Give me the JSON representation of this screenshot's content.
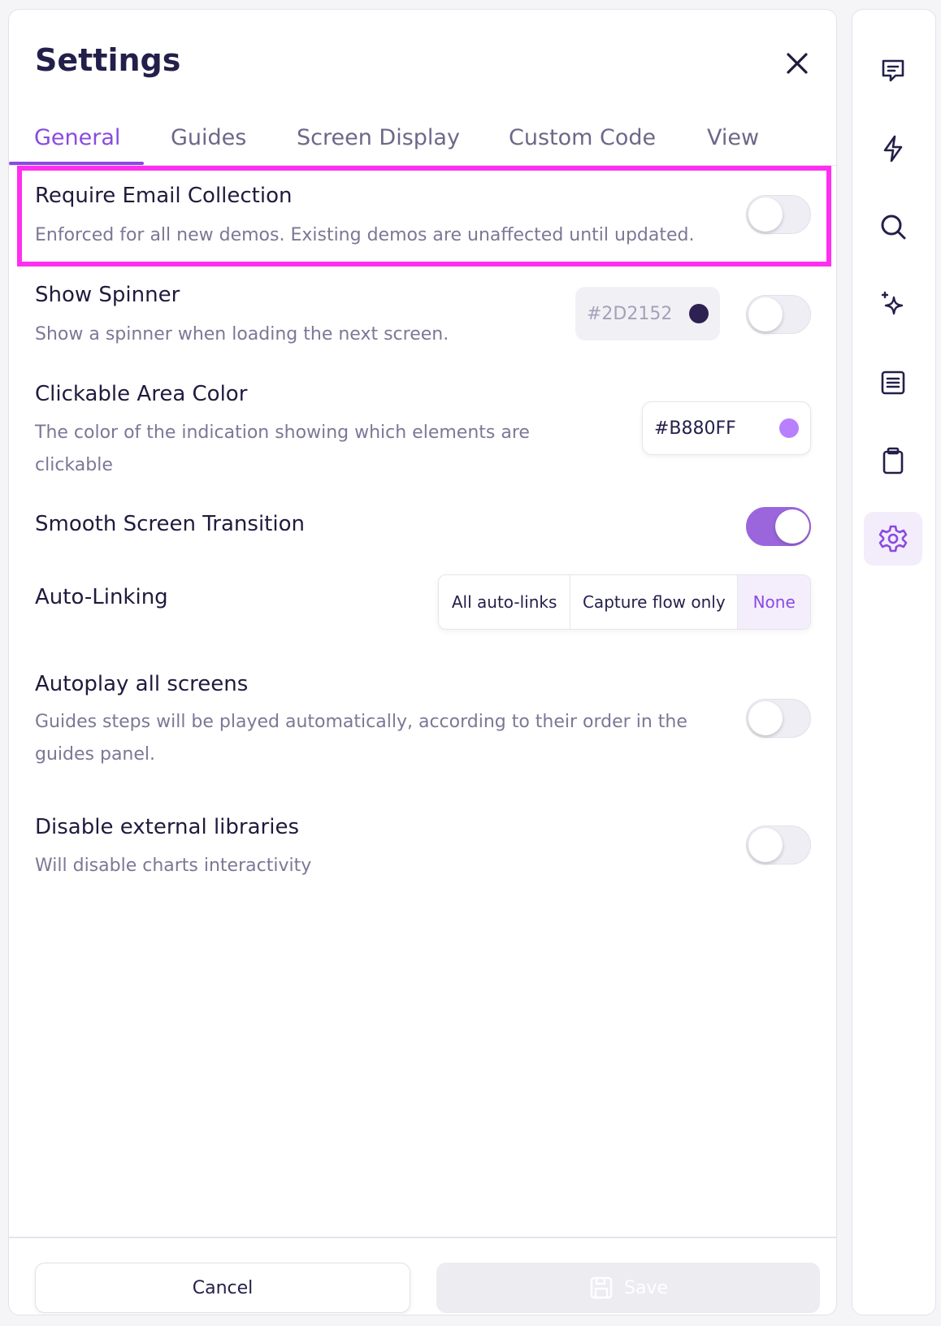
{
  "header": {
    "title": "Settings"
  },
  "tabs": [
    {
      "label": "General",
      "active": true
    },
    {
      "label": "Guides"
    },
    {
      "label": "Screen Display"
    },
    {
      "label": "Custom Code"
    },
    {
      "label": "View"
    }
  ],
  "settings": {
    "require_email": {
      "title": "Require Email Collection",
      "description": "Enforced for all new demos. Existing demos are unaffected until updated.",
      "enabled": false
    },
    "show_spinner": {
      "title": "Show Spinner",
      "description": "Show a spinner when loading the next screen.",
      "color": "#2D2152",
      "enabled": false
    },
    "clickable_area_color": {
      "title": "Clickable Area Color",
      "description": "The color of the indication showing which elements are clickable",
      "color": "#B880FF"
    },
    "smooth_transition": {
      "title": "Smooth Screen Transition",
      "enabled": true
    },
    "auto_linking": {
      "title": "Auto-Linking",
      "options": [
        "All auto-links",
        "Capture flow only",
        "None"
      ],
      "selected": "None"
    },
    "autoplay": {
      "title": "Autoplay all screens",
      "description": "Guides steps will be played automatically, according to their order in the guides panel.",
      "enabled": false
    },
    "disable_external": {
      "title": "Disable external libraries",
      "description": "Will disable charts interactivity",
      "enabled": false
    }
  },
  "footer": {
    "cancel_label": "Cancel",
    "save_label": "Save"
  },
  "rail": {
    "items": [
      {
        "icon": "comment-icon"
      },
      {
        "icon": "lightning-icon"
      },
      {
        "icon": "search-icon"
      },
      {
        "icon": "sparkle-icon"
      },
      {
        "icon": "document-icon"
      },
      {
        "icon": "clipboard-icon"
      },
      {
        "icon": "gear-icon",
        "active": true
      }
    ]
  },
  "colors": {
    "accent": "#8A4AE0",
    "toggle_on": "#9B66DC",
    "highlight": "#FF2FF0",
    "spinner_swatch": "#2D2152",
    "clickable_swatch": "#B880FF"
  }
}
